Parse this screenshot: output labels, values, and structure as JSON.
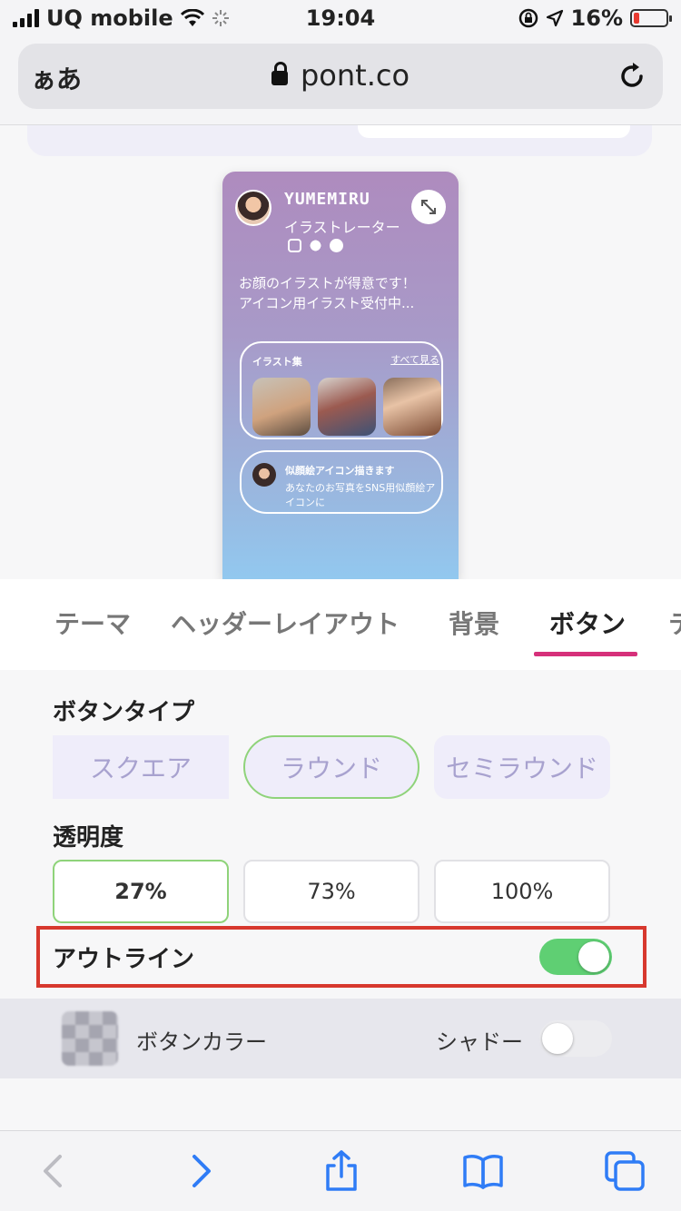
{
  "status": {
    "carrier": "UQ mobile",
    "time": "19:04",
    "battery": "16%",
    "battery_color": "#e83a30"
  },
  "urlbar": {
    "aa": "ぁあ",
    "domain": "pont.co",
    "lock_icon": "lock-icon",
    "reload_icon": "reload-icon"
  },
  "preview": {
    "name": "YUMEMIRU",
    "role": "イラストレーター",
    "social_icons": [
      "instagram-icon",
      "twitter-icon",
      "facebook-icon"
    ],
    "bio": "お顔のイラストが得意です！\nアイコン用イラスト受付中...",
    "gallery": {
      "title": "イラスト集",
      "see_all": "すべて見る"
    },
    "link": {
      "title": "似顔絵アイコン描きます",
      "desc": "あなたのお写真をSNS用似顔絵アイコンに"
    },
    "gradient": [
      "#ae8bbe",
      "#92c8ef"
    ]
  },
  "tabs": {
    "items": [
      "テーマ",
      "ヘッダーレイアウト",
      "背景",
      "ボタン",
      "テ"
    ],
    "active": "ボタン",
    "accent": "#d6307a"
  },
  "button_type": {
    "heading": "ボタンタイプ",
    "options": [
      "スクエア",
      "ラウンド",
      "セミラウンド"
    ],
    "selected": "ラウンド"
  },
  "opacity": {
    "heading": "透明度",
    "options": [
      "27%",
      "73%",
      "100%"
    ],
    "selected": "27%"
  },
  "outline": {
    "label": "アウトライン",
    "enabled": true,
    "toggle_color": "#5fcf73",
    "highlight_color": "#d7382e"
  },
  "color_row": {
    "button_color_label": "ボタンカラー",
    "shadow_label": "シャドー",
    "shadow_enabled": false
  },
  "toolbar": {
    "icons": [
      "back-icon",
      "forward-icon",
      "share-icon",
      "bookmarks-icon",
      "tabs-icon"
    ]
  }
}
